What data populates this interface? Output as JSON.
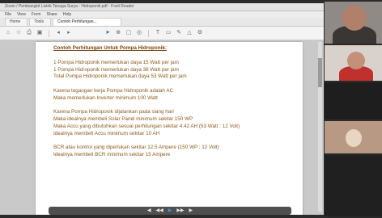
{
  "window": {
    "title": "Zoom / Pembangkit Listrik Tenaga Surya - Hidroponik.pdf - Foxit Reader",
    "menu": [
      "File",
      "View",
      "Form",
      "Share",
      "Help"
    ],
    "tabs": [
      "Home",
      "Tools",
      "Contoh Perhitungan..."
    ]
  },
  "toolbar": {
    "icons": [
      "home-icon",
      "star-icon",
      "print-icon",
      "save-icon",
      "back-icon",
      "forward-icon",
      "cursor-icon",
      "zoom-icon",
      "page-icon",
      "fit-icon",
      "text-icon",
      "comment-icon",
      "sign-icon",
      "share-icon"
    ]
  },
  "document": {
    "heading": "Contoh Perhitungan Untuk Pompa Hidroponik:",
    "block1": [
      "1 Pompa Hidroponik memerlukan daya 15 Watt per jam",
      "1 Pompa Hidroponik memerlukan daya 38 Watt per jam",
      "Total Pompa Hidroponik memerlukan daya 53 Watt per jam"
    ],
    "block2": [
      "Karena tegangan kerja Pompa Hidroponik adalah AC",
      "Maka memerlukan Inverter minimum 100 Watt"
    ],
    "block3": [
      "Karena Pompa Hidroponik dijalankan pada siang hari",
      "Maka idealnya membeli Solar Panel minimum sekitar 150 WP",
      "Maka Accu yang dibutuhkan sesuai perhitungan sekitar 4.42 AH (53 Watt : 12 Volt)",
      "Idealnya membeli Accu minimum sekitar 10 AH"
    ],
    "block4": [
      "BCR atau kontrol yang diperlukan sekitar 12.5 Ampere (150 WP : 12 Volt)",
      "Idealnya membeli BCR minimum sekitar 15 Ampere"
    ]
  },
  "colors": {
    "text": "#8a5a1c",
    "heading": "#7a4410",
    "page": "#ffffff",
    "viewer_bg": "#c9c9c9"
  }
}
